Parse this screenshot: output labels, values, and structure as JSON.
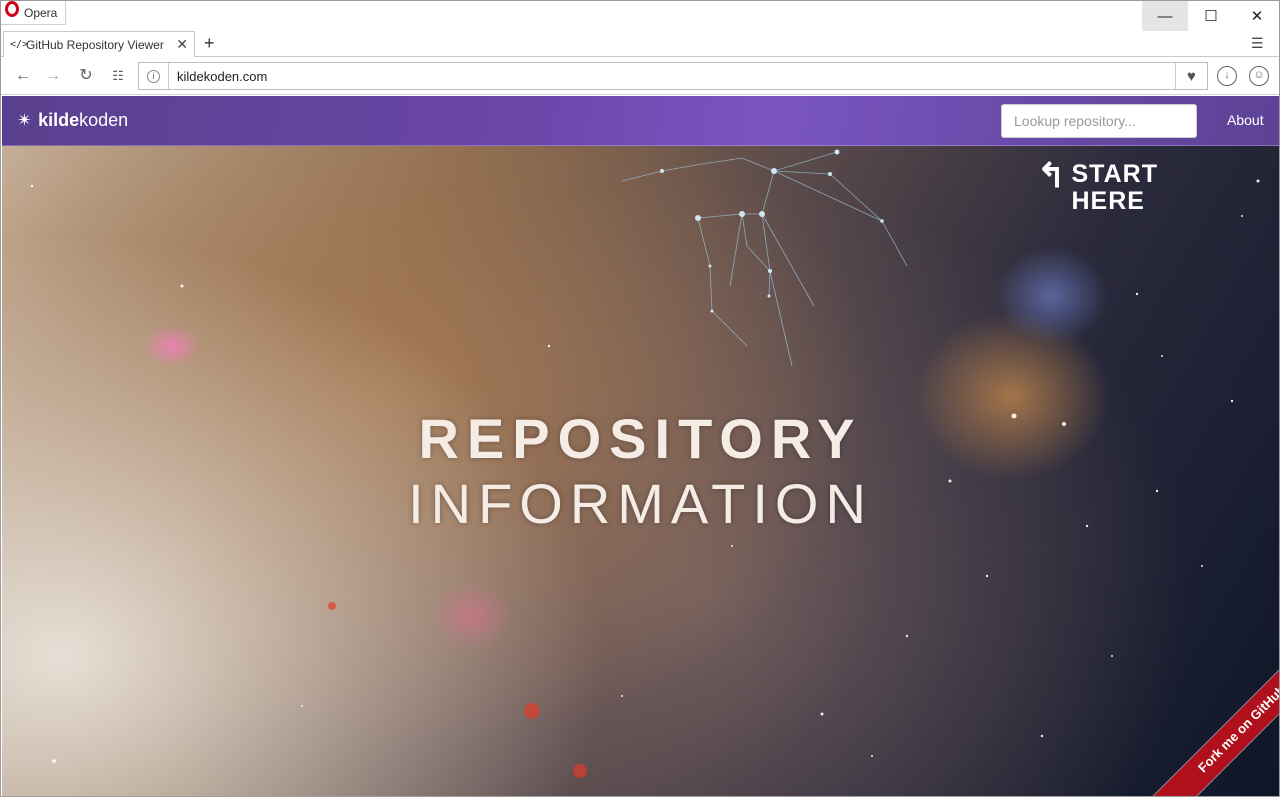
{
  "window": {
    "app_name": "Opera"
  },
  "tab": {
    "icon": "</>",
    "title": "GitHub Repository Viewer"
  },
  "address_bar": {
    "url": "kildekoden.com"
  },
  "site": {
    "brand_bold": "kilde",
    "brand_light": "koden",
    "lookup_placeholder": "Lookup repository...",
    "about_label": "About",
    "start_line1": "START",
    "start_line2": "HERE",
    "hero_line1": "REPOSITORY",
    "hero_line2": "INFORMATION",
    "ribbon_label": "Fork me on GitHub"
  },
  "colors": {
    "nav_purple": "#6a46a8",
    "ribbon_red": "#b0101b"
  }
}
